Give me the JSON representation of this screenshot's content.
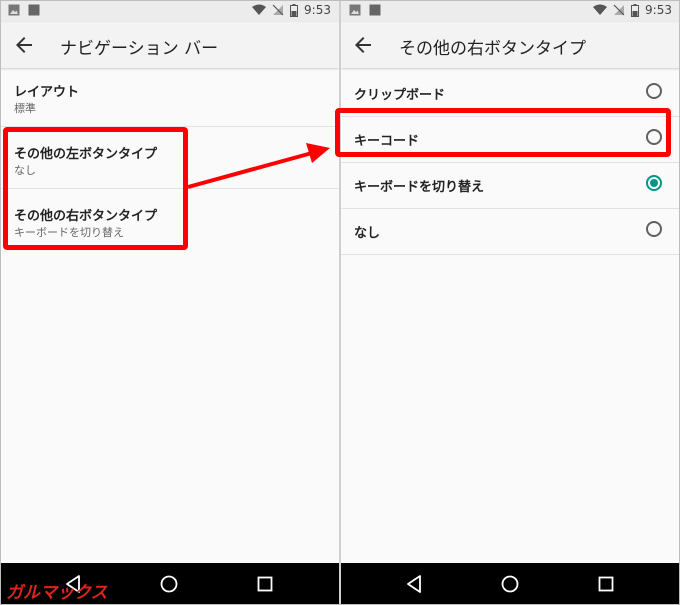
{
  "status": {
    "time": "9:53"
  },
  "left": {
    "title": "ナビゲーション バー",
    "items": [
      {
        "title": "レイアウト",
        "summary": "標準"
      },
      {
        "title": "その他の左ボタンタイプ",
        "summary": "なし"
      },
      {
        "title": "その他の右ボタンタイプ",
        "summary": "キーボードを切り替え"
      }
    ]
  },
  "right": {
    "title": "その他の右ボタンタイプ",
    "options": [
      {
        "label": "クリップボード",
        "selected": false
      },
      {
        "label": "キーコード",
        "selected": false
      },
      {
        "label": "キーボードを切り替え",
        "selected": true
      },
      {
        "label": "なし",
        "selected": false
      }
    ]
  },
  "logo": "ガルマックス",
  "colors": {
    "accent": "#009688",
    "highlight": "#ff0000",
    "navbar": "#000000"
  },
  "icons": [
    "image-icon",
    "notification-square-icon",
    "wifi-icon",
    "no-signal-icon",
    "battery-icon",
    "back-arrow-icon",
    "nav-back-icon",
    "nav-home-icon",
    "nav-recents-icon"
  ]
}
